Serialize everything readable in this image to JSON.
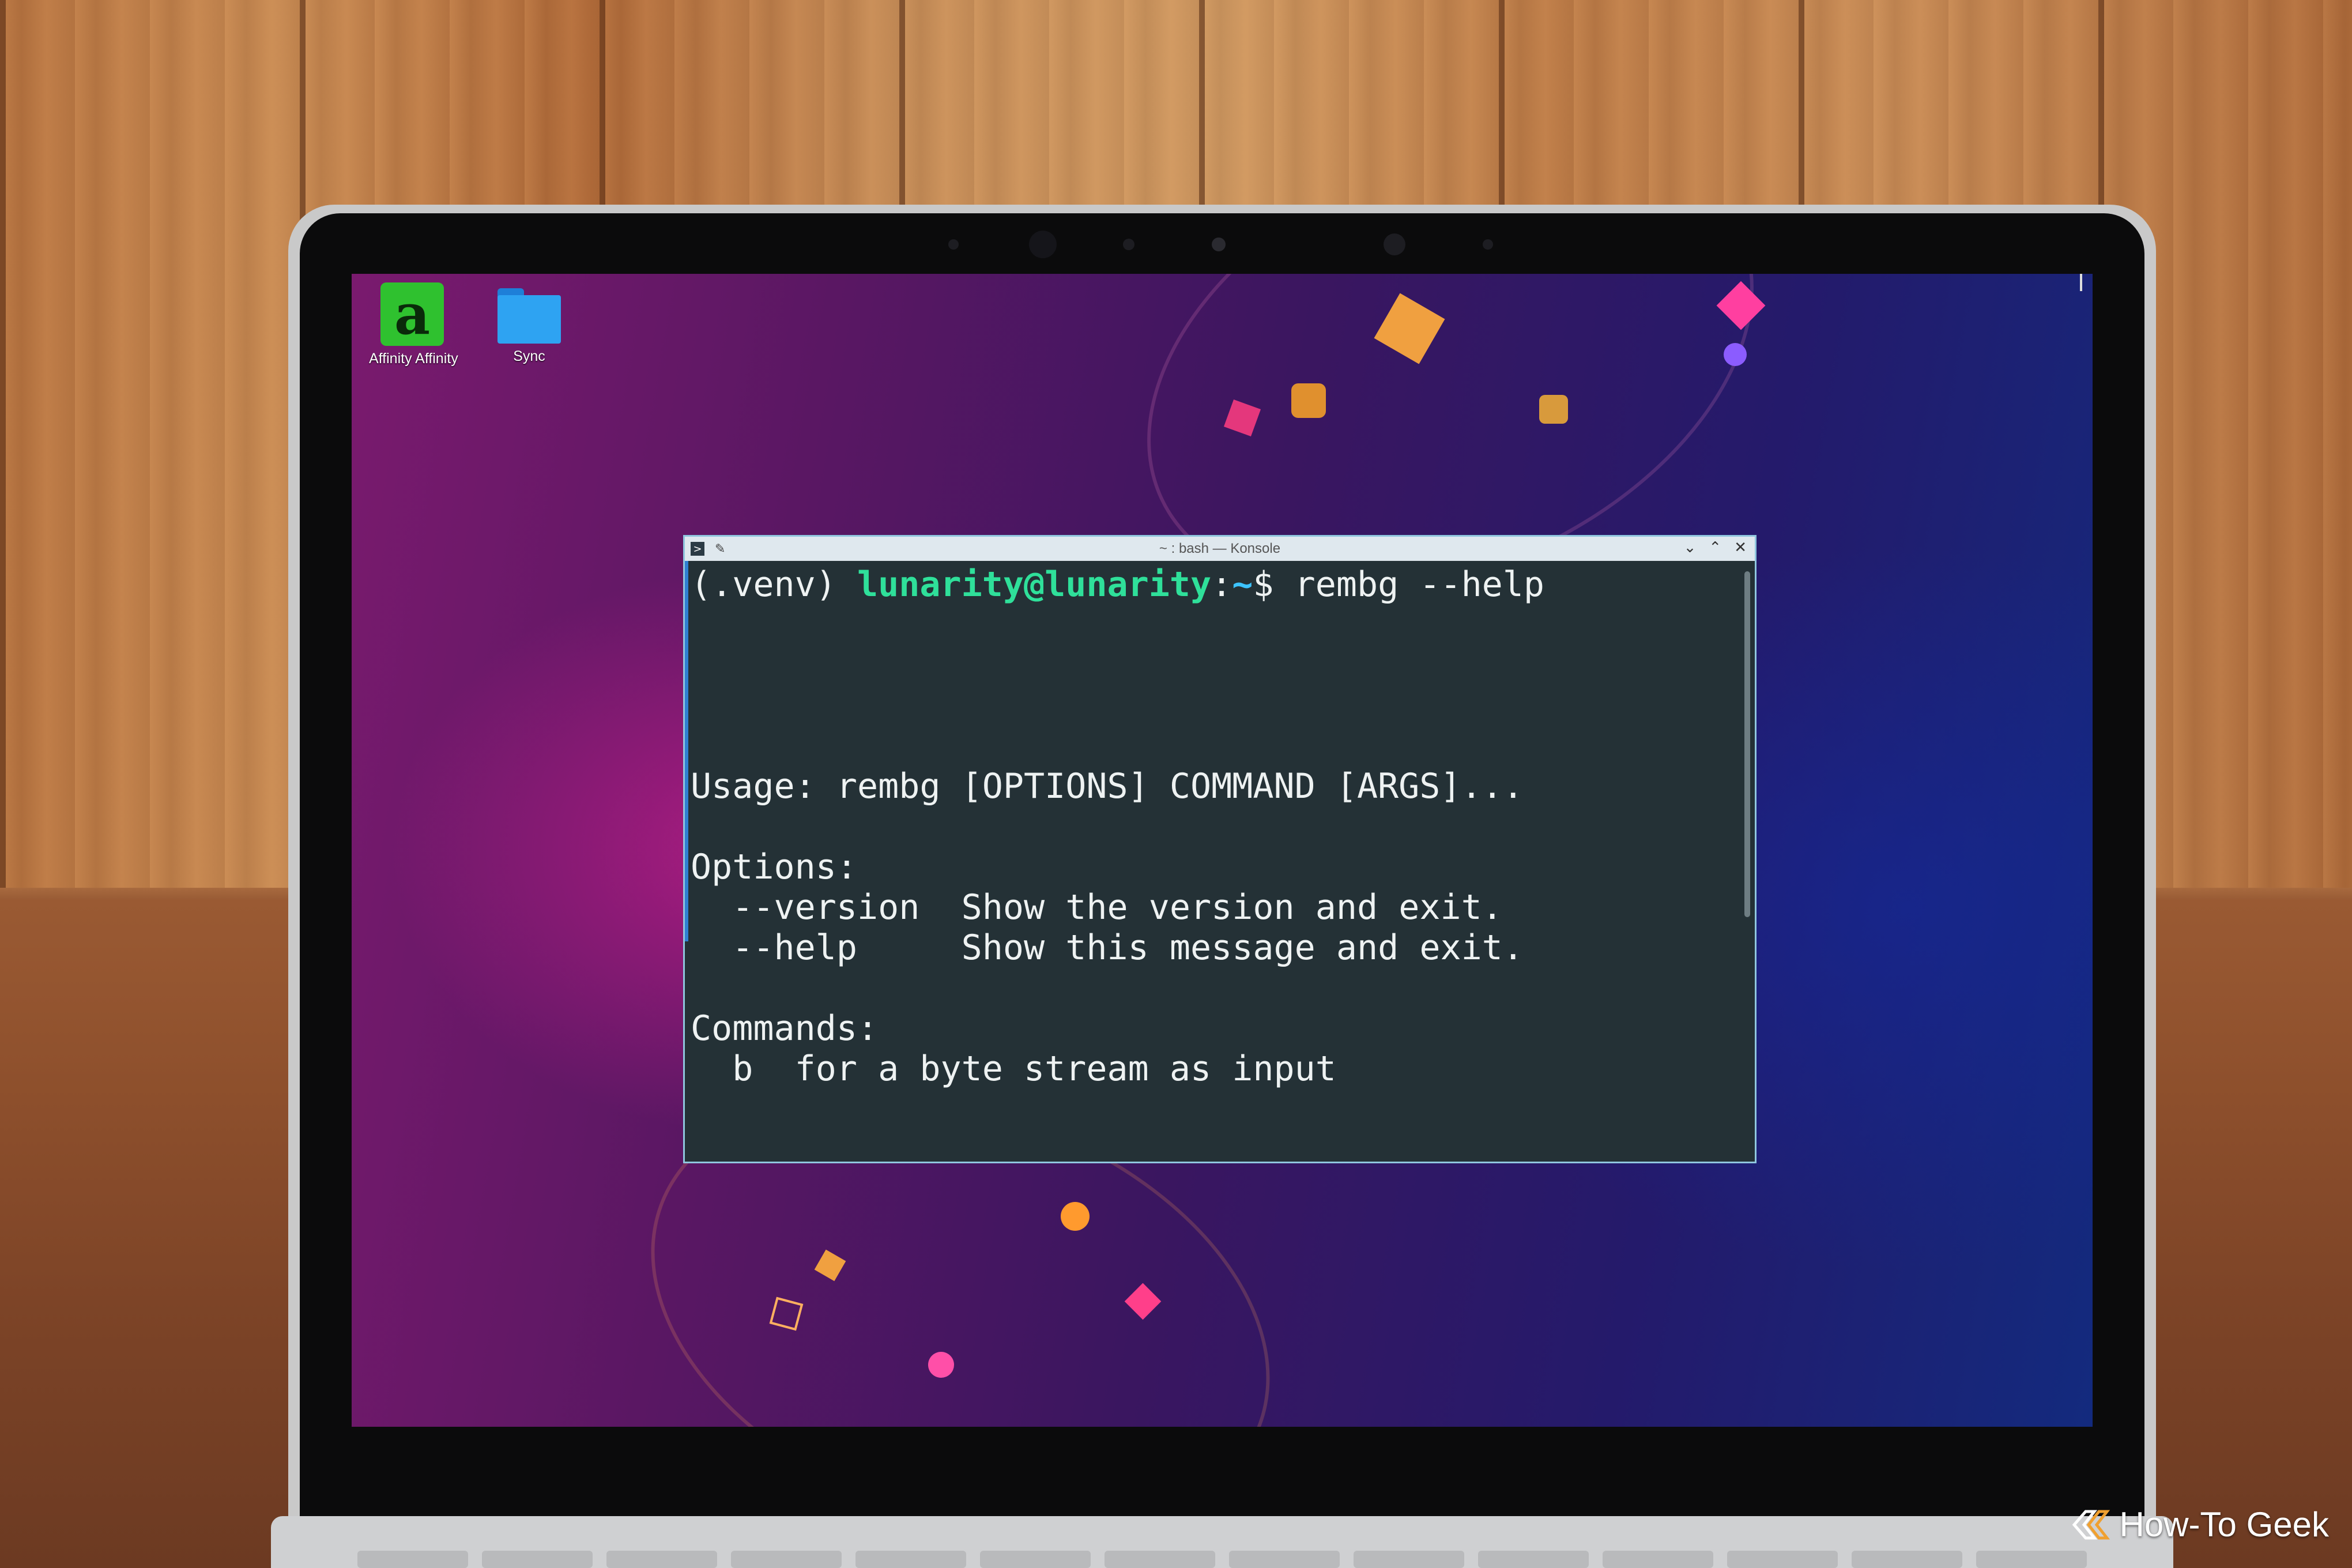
{
  "desktop": {
    "icons": [
      {
        "label": "Affinity Affinity",
        "icon": "affinity-icon"
      },
      {
        "label": "Sync",
        "icon": "folder-icon"
      }
    ]
  },
  "konsole": {
    "title": "~ : bash — Konsole",
    "buttons": {
      "minimize": "⌄",
      "maximize": "⌃",
      "close": "✕"
    },
    "prompt": {
      "venv": "(.venv) ",
      "user_host": "lunarity@lunarity",
      "colon": ":",
      "path": "~",
      "dollar": "$ ",
      "command": "rembg --help"
    },
    "output": {
      "usage": "Usage: rembg [OPTIONS] COMMAND [ARGS]...",
      "options_header": "Options:",
      "options": [
        {
          "flag": "  --version",
          "desc": "Show the version and exit."
        },
        {
          "flag": "  --help   ",
          "desc": "Show this message and exit."
        }
      ],
      "commands_header": "Commands:",
      "commands": [
        {
          "name": "  b",
          "desc": "for a byte stream as input"
        }
      ]
    }
  },
  "watermark": "How-To Geek",
  "colors": {
    "prompt_user": "#2fe09a",
    "prompt_path": "#3cc3ff",
    "terminal_bg": "#243136",
    "window_border": "#8fc6de"
  }
}
